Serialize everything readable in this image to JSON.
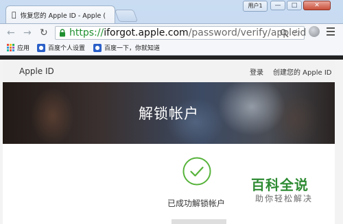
{
  "browser": {
    "tab_title": "恢复您的 Apple ID - Apple (",
    "user_label": "用户1",
    "window_controls": {
      "minimize": "—",
      "maximize": "□",
      "close": "✕"
    },
    "url": {
      "scheme": "https://",
      "host": "iforgot.apple.com",
      "path": "/password/verify/appleid"
    },
    "bookmarks": [
      {
        "label": "应用",
        "icon": "apps-grid-icon"
      },
      {
        "label": "百度个人设置",
        "icon": "baidu-paw-icon"
      },
      {
        "label": "百度一下，你就知道",
        "icon": "baidu-paw-icon"
      }
    ],
    "colors": {
      "secure_green": "#1e8f2e",
      "tab_bg": "#c9dcf2"
    }
  },
  "page": {
    "nav": {
      "brand": "Apple ID",
      "sign_in": "登录",
      "create": "创建您的 Apple ID"
    },
    "hero": {
      "title": "解锁帐户"
    },
    "success": {
      "message": "已成功解锁帐户",
      "icon": "checkmark-circle-icon",
      "color": "#56b33a"
    }
  },
  "watermark": {
    "title": "百科全说",
    "subtitle": "助你轻松解决",
    "color": "#2e8b33"
  }
}
